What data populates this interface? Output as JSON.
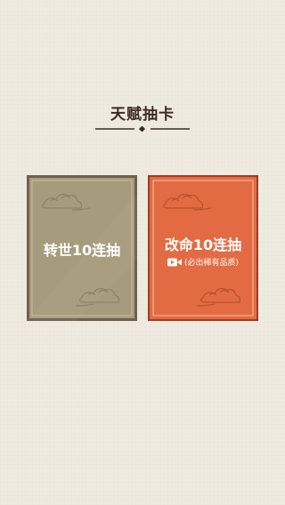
{
  "header": {
    "title": "天赋抽卡"
  },
  "cards": [
    {
      "label": "转世10连抽",
      "color": "#a69b7c"
    },
    {
      "label": "改命10连抽",
      "sub_label": "(必出稀有品质)",
      "sub_icon": "video-icon",
      "color": "#e36b44"
    }
  ],
  "colors": {
    "background": "#efebe1",
    "title_text": "#3d2a23",
    "card_grey": "#a69b7c",
    "card_orange": "#e36b44",
    "card_border_dark": "#6b5a47"
  }
}
